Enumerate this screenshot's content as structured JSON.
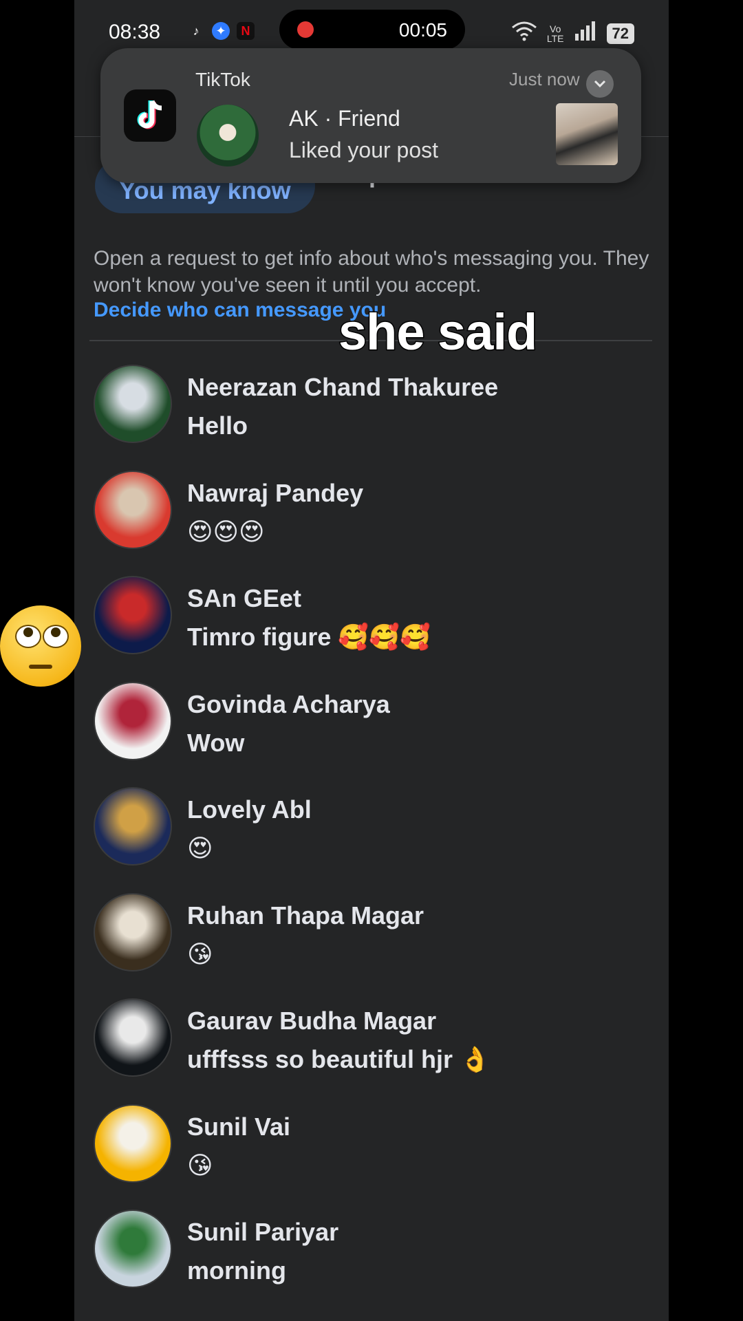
{
  "status_bar": {
    "time": "08:38",
    "app_icons": [
      "tiktok-icon",
      "messenger-icon",
      "netflix-icon"
    ],
    "recording_timer": "00:05",
    "battery": "72"
  },
  "notification": {
    "app_name": "TikTok",
    "timestamp": "Just now",
    "title": "AK · Friend",
    "body": "Liked your post"
  },
  "tabs": {
    "you_may_know": "You may know",
    "spam": "Spam"
  },
  "info": {
    "text": "Open a request to get info about who's messaging you. They won't know you've seen it until you accept.",
    "link": "Decide who can message you"
  },
  "caption": "she said",
  "requests": [
    {
      "name": "Neerazan Chand Thakuree",
      "message": "Hello",
      "colors": [
        "#1f4d2a",
        "#d7dde3"
      ]
    },
    {
      "name": "Nawraj Pandey",
      "message": "😍😍😍",
      "colors": [
        "#d93a2f",
        "#d9c6b0"
      ]
    },
    {
      "name": "SAn GEet",
      "message": "Timro figure 🥰🥰🥰",
      "colors": [
        "#0d1b4a",
        "#c92a2a"
      ]
    },
    {
      "name": "Govinda Acharya",
      "message": "Wow",
      "colors": [
        "#f2f2f2",
        "#b0243a"
      ]
    },
    {
      "name": "Lovely Abl",
      "message": "😍",
      "colors": [
        "#1b2a5a",
        "#d0a046"
      ]
    },
    {
      "name": "Ruhan Thapa Magar",
      "message": "😘",
      "colors": [
        "#3a2e1e",
        "#e8e0d2"
      ]
    },
    {
      "name": "Gaurav Budha Magar",
      "message": "ufffsss so beautiful hjr 👌",
      "colors": [
        "#101418",
        "#e9e9e9"
      ]
    },
    {
      "name": "Sunil Vai",
      "message": "😘",
      "colors": [
        "#f5b300",
        "#f4f1e8"
      ]
    },
    {
      "name": "Sunil Pariyar",
      "message": "morning",
      "colors": [
        "#c8d4de",
        "#2f7a3a"
      ]
    }
  ]
}
